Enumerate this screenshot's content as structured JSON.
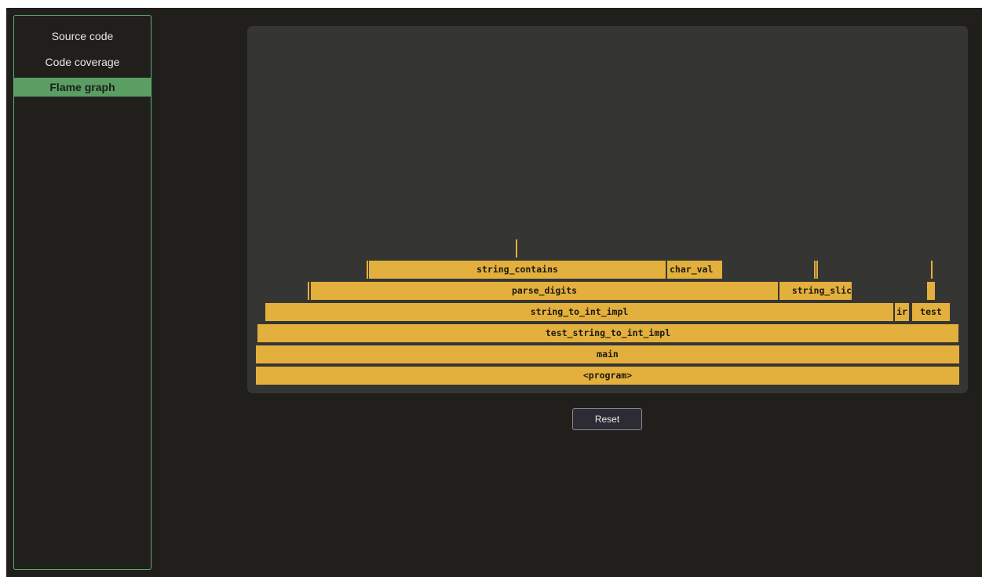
{
  "sidebar": {
    "items": [
      {
        "label": "Source code",
        "active": false
      },
      {
        "label": "Code coverage",
        "active": false
      },
      {
        "label": "Flame graph",
        "active": true
      }
    ]
  },
  "flame_graph": {
    "frames": {
      "program": "<program>",
      "main": "main",
      "test_string_to_int_impl": "test_string_to_int_impl",
      "string_to_int_impl": "string_to_int_impl",
      "ir": "ir",
      "test": "test",
      "parse_digits": "parse_digits",
      "string_slice": "string_slic",
      "string_contains": "string_contains",
      "char_val": "char_val"
    }
  },
  "reset_label": "Reset",
  "colors": {
    "background": "#201f1c",
    "panel": "#353533",
    "frame": "#e3b03d",
    "accent": "#5a9e63"
  }
}
